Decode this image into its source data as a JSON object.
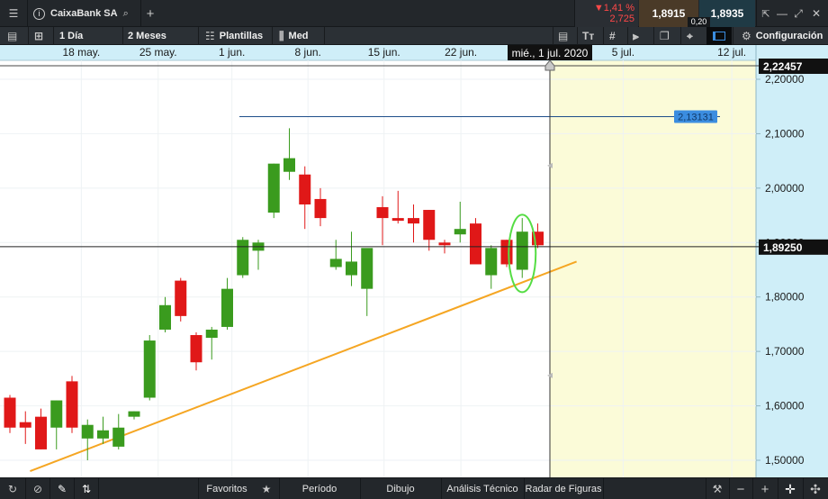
{
  "header": {
    "instrument": "CaixaBank SA",
    "change_pct": "▼1,41 %",
    "change_abs": "2,725",
    "bid": "1,8915",
    "ask": "1,8935",
    "spread": "0,20"
  },
  "toolbar": {
    "interval": "1 Día",
    "range": "2 Meses",
    "templates": "Plantillas",
    "price_type": "Med",
    "config": "Configuración"
  },
  "bottom": {
    "favorites": "Favoritos",
    "period": "Período",
    "drawing": "Dibujo",
    "technical": "Análisis Técnico",
    "radar": "Radar de Figuras"
  },
  "colors": {
    "up": "#3a9b1e",
    "down": "#e01818",
    "trendline": "#f5a623",
    "hline": "#1f4f8a",
    "highlight": "#55dd44",
    "future_zone": "#fbfbd8"
  },
  "chart_data": {
    "type": "candlestick",
    "x_ticks": [
      "18 may.",
      "25 may.",
      "1 jun.",
      "8 jun.",
      "15 jun.",
      "22 jun.",
      "5 jul.",
      "12 jul."
    ],
    "crosshair_date": "mié., 1 jul. 2020",
    "y_ticks": [
      "2,20000",
      "2,10000",
      "2,00000",
      "1,90000",
      "1,80000",
      "1,70000",
      "1,60000",
      "1,50000"
    ],
    "ylim": [
      1.48,
      2.24
    ],
    "y_top_label": "2,22457",
    "current_price": 1.8925,
    "current_price_label": "1,89250",
    "hline_value": 2.1313,
    "hline_label": "2,13131",
    "candles": [
      {
        "o": 1.615,
        "h": 1.62,
        "l": 1.55,
        "c": 1.56
      },
      {
        "o": 1.57,
        "h": 1.59,
        "l": 1.53,
        "c": 1.56
      },
      {
        "o": 1.58,
        "h": 1.595,
        "l": 1.52,
        "c": 1.52
      },
      {
        "o": 1.56,
        "h": 1.61,
        "l": 1.52,
        "c": 1.61
      },
      {
        "o": 1.645,
        "h": 1.655,
        "l": 1.55,
        "c": 1.56
      },
      {
        "o": 1.54,
        "h": 1.575,
        "l": 1.5,
        "c": 1.565
      },
      {
        "o": 1.54,
        "h": 1.58,
        "l": 1.53,
        "c": 1.555
      },
      {
        "o": 1.525,
        "h": 1.585,
        "l": 1.52,
        "c": 1.56
      },
      {
        "o": 1.58,
        "h": 1.59,
        "l": 1.575,
        "c": 1.59
      },
      {
        "o": 1.615,
        "h": 1.73,
        "l": 1.61,
        "c": 1.72
      },
      {
        "o": 1.74,
        "h": 1.8,
        "l": 1.735,
        "c": 1.785
      },
      {
        "o": 1.83,
        "h": 1.835,
        "l": 1.755,
        "c": 1.765
      },
      {
        "o": 1.73,
        "h": 1.735,
        "l": 1.665,
        "c": 1.68
      },
      {
        "o": 1.725,
        "h": 1.745,
        "l": 1.685,
        "c": 1.74
      },
      {
        "o": 1.745,
        "h": 1.835,
        "l": 1.74,
        "c": 1.815
      },
      {
        "o": 1.84,
        "h": 1.91,
        "l": 1.835,
        "c": 1.905
      },
      {
        "o": 1.885,
        "h": 1.905,
        "l": 1.85,
        "c": 1.9
      },
      {
        "o": 1.955,
        "h": 2.045,
        "l": 1.945,
        "c": 2.045
      },
      {
        "o": 2.03,
        "h": 2.11,
        "l": 2.015,
        "c": 2.055
      },
      {
        "o": 2.025,
        "h": 2.04,
        "l": 1.925,
        "c": 1.97
      },
      {
        "o": 1.98,
        "h": 2.0,
        "l": 1.93,
        "c": 1.945
      },
      {
        "o": 1.855,
        "h": 1.905,
        "l": 1.85,
        "c": 1.87
      },
      {
        "o": 1.84,
        "h": 1.92,
        "l": 1.82,
        "c": 1.865
      },
      {
        "o": 1.815,
        "h": 1.875,
        "l": 1.765,
        "c": 1.89
      },
      {
        "o": 1.965,
        "h": 1.985,
        "l": 1.895,
        "c": 1.945
      },
      {
        "o": 1.945,
        "h": 1.995,
        "l": 1.935,
        "c": 1.94
      },
      {
        "o": 1.945,
        "h": 1.97,
        "l": 1.9,
        "c": 1.935
      },
      {
        "o": 1.96,
        "h": 1.96,
        "l": 1.885,
        "c": 1.905
      },
      {
        "o": 1.9,
        "h": 1.905,
        "l": 1.88,
        "c": 1.895
      },
      {
        "o": 1.915,
        "h": 1.975,
        "l": 1.9,
        "c": 1.925
      },
      {
        "o": 1.935,
        "h": 1.945,
        "l": 1.865,
        "c": 1.86
      },
      {
        "o": 1.84,
        "h": 1.895,
        "l": 1.815,
        "c": 1.89
      },
      {
        "o": 1.905,
        "h": 1.905,
        "l": 1.855,
        "c": 1.86
      },
      {
        "o": 1.85,
        "h": 1.945,
        "l": 1.835,
        "c": 1.92
      },
      {
        "o": 1.92,
        "h": 1.935,
        "l": 1.89,
        "c": 1.895
      }
    ],
    "trendline": [
      [
        1.48,
        1.3
      ],
      [
        1.865,
        36.5
      ]
    ]
  }
}
